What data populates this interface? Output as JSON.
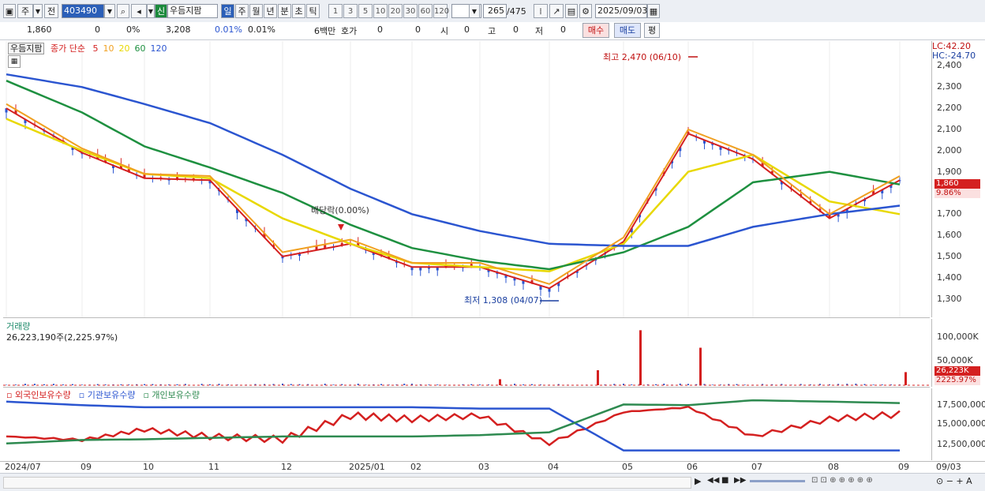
{
  "toolbar": {
    "market": "주",
    "prev_label": "전",
    "code": "403490",
    "credit_label": "신",
    "name": "우듬지팜",
    "periods": [
      "일",
      "주",
      "월",
      "년",
      "분",
      "초",
      "틱"
    ],
    "active_period": "일",
    "intervals": [
      "1",
      "3",
      "5",
      "10",
      "20",
      "30",
      "60",
      "120"
    ],
    "view_count": "265",
    "total_count": "/475",
    "date": "2025/09/03"
  },
  "quote": {
    "price": "1,860",
    "change": "0",
    "change_pct": "0%",
    "volume": "3,208",
    "turnover_pct": "0.01%",
    "turnover_pct2": "0.01%",
    "amount": "6백만",
    "hoga_label": "호가",
    "bid": "0",
    "ask": "0",
    "open_label": "시",
    "open": "0",
    "high_label": "고",
    "high": "0",
    "low_label": "저",
    "low": "0",
    "buy_label": "매수",
    "sell_label": "매도",
    "avg_label": "평"
  },
  "price_pane": {
    "stock_label": "우듬지팜",
    "ma_title": "종가 단순",
    "ma_periods": [
      {
        "label": "5",
        "color": "#d42020"
      },
      {
        "label": "10",
        "color": "#f0a020"
      },
      {
        "label": "20",
        "color": "#e8d800"
      },
      {
        "label": "60",
        "color": "#1e9040"
      },
      {
        "label": "120",
        "color": "#2b55d0"
      }
    ],
    "lc": "LC:42.20",
    "hc": "HC:-24.70",
    "yticks": [
      "2,400",
      "2,300",
      "2,200",
      "2,100",
      "2,000",
      "1,900",
      "1,800",
      "1,700",
      "1,600",
      "1,500",
      "1,400",
      "1,300"
    ],
    "current_price": "1,860",
    "current_pct": "9.86%",
    "high_annotation": "최고 2,470 (06/10)",
    "low_annotation": "최저 1,308 (04/07)",
    "dividend_annotation": "배당락(0.00%)"
  },
  "volume_pane": {
    "title": "거래량",
    "value": "26,223,190주(2,225.97%)",
    "yticks": [
      "100,000K",
      "50,000K"
    ],
    "current": "26,223K",
    "current_pct": "2225.97%"
  },
  "holdings_pane": {
    "series": [
      {
        "name": "외국인보유수량",
        "color": "#d42020"
      },
      {
        "name": "기관보유수량",
        "color": "#2b55d0"
      },
      {
        "name": "개인보유수량",
        "color": "#2e8a50"
      }
    ],
    "yticks": [
      "17,500,000",
      "15,000,000",
      "12,500,000"
    ]
  },
  "xaxis": {
    "labels": [
      "2024/07",
      "09",
      "10",
      "11",
      "12",
      "2025/01",
      "02",
      "03",
      "04",
      "05",
      "06",
      "07",
      "08",
      "09"
    ],
    "right_label": "09/03"
  },
  "chart_data": {
    "type": "line",
    "title": "",
    "price_range": [
      1250,
      2480
    ],
    "x": [
      "2024/07",
      "09",
      "10",
      "11",
      "12",
      "2025/01",
      "02",
      "03",
      "04",
      "05",
      "06",
      "07",
      "08",
      "09"
    ],
    "series": [
      {
        "name": "종가",
        "values": [
          2200,
          1990,
          1870,
          1860,
          1500,
          1560,
          1450,
          1450,
          1350,
          1570,
          2080,
          1960,
          1680,
          1860
        ]
      },
      {
        "name": "20",
        "values": [
          2150,
          2000,
          1890,
          1870,
          1680,
          1560,
          1470,
          1450,
          1430,
          1560,
          1900,
          1980,
          1760,
          1700
        ]
      },
      {
        "name": "60",
        "values": [
          2330,
          2180,
          2020,
          1920,
          1800,
          1650,
          1540,
          1480,
          1440,
          1520,
          1640,
          1850,
          1900,
          1840
        ]
      },
      {
        "name": "120",
        "values": [
          2360,
          2300,
          2220,
          2130,
          1980,
          1820,
          1700,
          1620,
          1560,
          1550,
          1550,
          1640,
          1700,
          1740
        ]
      },
      {
        "name": "외국인보유수량",
        "values": [
          13000,
          12500,
          14000,
          13000,
          12600,
          16000,
          15500,
          16000,
          12000,
          16500,
          17200,
          13000,
          15500,
          16200
        ]
      },
      {
        "name": "기관보유수량",
        "values": [
          18000,
          17500,
          17200,
          17200,
          17200,
          17200,
          17200,
          17000,
          17000,
          11000,
          11000,
          11000,
          11000,
          11000
        ]
      },
      {
        "name": "개인보유수량",
        "values": [
          12000,
          12500,
          12600,
          12800,
          13000,
          13000,
          13000,
          13200,
          13600,
          17600,
          17500,
          18200,
          18000,
          17800
        ]
      }
    ],
    "volume_peaks": [
      {
        "date": "03",
        "value": 12000
      },
      {
        "date": "04",
        "value": 30000
      },
      {
        "date": "05",
        "value": 110000
      },
      {
        "date": "06",
        "value": 75000
      },
      {
        "date": "09",
        "value": 26223
      }
    ]
  }
}
